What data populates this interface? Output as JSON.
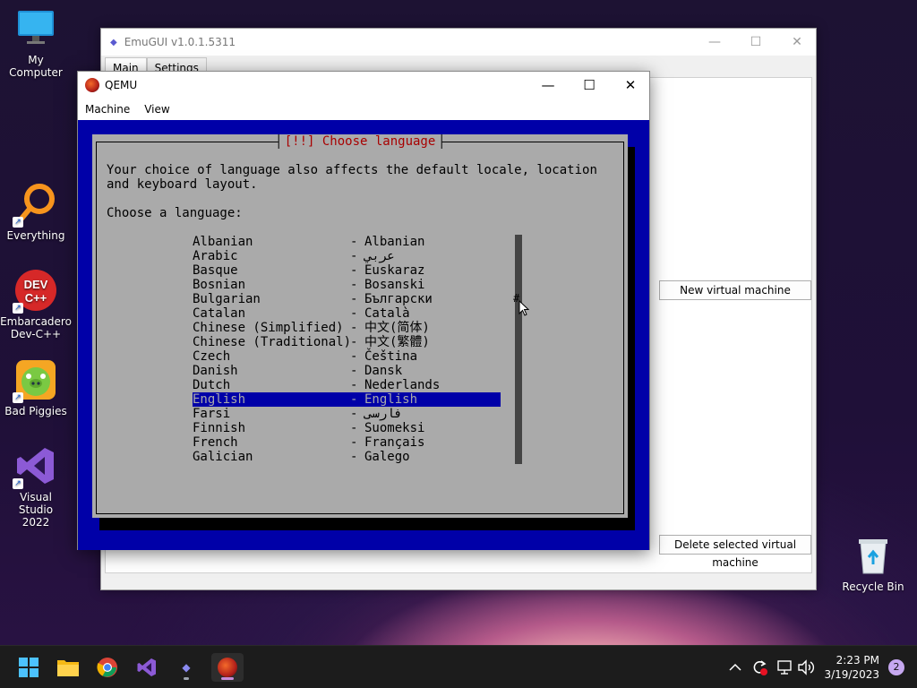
{
  "desktop": {
    "icons": [
      {
        "label": "My Computer"
      },
      {
        "label": "Everything"
      },
      {
        "label": "Embarcadero Dev-C++"
      },
      {
        "label": "Bad Piggies"
      },
      {
        "label": "Visual Studio 2022"
      },
      {
        "label": "Recycle Bin"
      }
    ]
  },
  "emugui": {
    "title": "EmuGUI v1.0.1.5311",
    "tabs": [
      "Main",
      "Settings"
    ],
    "new_vm_label": "New virtual machine",
    "delete_vm_label": "Delete selected virtual machine"
  },
  "qemu": {
    "title": "QEMU",
    "menu": [
      "Machine",
      "View"
    ],
    "dialog": {
      "title": "[!!] Choose language",
      "description": "Your choice of language also affects the default locale, location and keyboard layout.",
      "prompt": "Choose a language:",
      "languages": [
        {
          "name": "Albanian",
          "native": "Albanian"
        },
        {
          "name": "Arabic",
          "native": "عربي"
        },
        {
          "name": "Basque",
          "native": "Euskaraz"
        },
        {
          "name": "Bosnian",
          "native": "Bosanski"
        },
        {
          "name": "Bulgarian",
          "native": "Български"
        },
        {
          "name": "Catalan",
          "native": "Català"
        },
        {
          "name": "Chinese (Simplified)",
          "native": "中文(简体)"
        },
        {
          "name": "Chinese (Traditional)",
          "native": "中文(繁體)"
        },
        {
          "name": "Czech",
          "native": "Čeština"
        },
        {
          "name": "Danish",
          "native": "Dansk"
        },
        {
          "name": "Dutch",
          "native": "Nederlands"
        },
        {
          "name": "English",
          "native": "English"
        },
        {
          "name": "Farsi",
          "native": "فارسی"
        },
        {
          "name": "Finnish",
          "native": "Suomeksi"
        },
        {
          "name": "French",
          "native": "Français"
        },
        {
          "name": "Galician",
          "native": "Galego"
        }
      ],
      "selected_language": "English",
      "scroll_marker": "#"
    }
  },
  "taskbar": {
    "apps": [
      "start-icon",
      "file-explorer-icon",
      "chrome-icon",
      "visual-studio-icon",
      "emugui-icon",
      "qemu-icon"
    ],
    "clock_time": "2:23 PM",
    "clock_date": "3/19/2023",
    "notification_count": "2"
  }
}
